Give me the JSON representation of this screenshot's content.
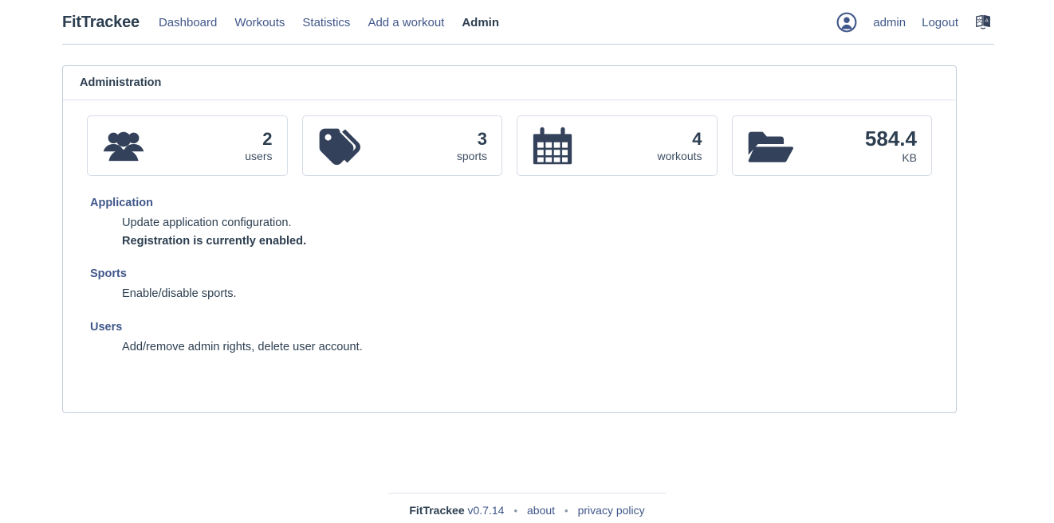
{
  "header": {
    "brand": "FitTrackee",
    "nav": [
      {
        "label": "Dashboard",
        "name": "nav-dashboard",
        "active": false
      },
      {
        "label": "Workouts",
        "name": "nav-workouts",
        "active": false
      },
      {
        "label": "Statistics",
        "name": "nav-statistics",
        "active": false
      },
      {
        "label": "Add a workout",
        "name": "nav-add-a-workout",
        "active": false
      },
      {
        "label": "Admin",
        "name": "nav-admin",
        "active": true
      }
    ],
    "username": "admin",
    "logout": "Logout",
    "avatar_icon": "user-circle-icon",
    "language_icon": "language-icon"
  },
  "card": {
    "title": "Administration"
  },
  "stats": [
    {
      "icon": "users-icon",
      "value": "2",
      "label": "users",
      "name": "stat-card-users"
    },
    {
      "icon": "tags-icon",
      "value": "3",
      "label": "sports",
      "name": "stat-card-sports"
    },
    {
      "icon": "calendar-icon",
      "value": "4",
      "label": "workouts",
      "name": "stat-card-workouts"
    },
    {
      "icon": "folder-open-icon",
      "value": "584.4",
      "label": "KB",
      "name": "stat-card-storage"
    }
  ],
  "sections": [
    {
      "title": "Application",
      "name": "section-application",
      "lines": [
        {
          "text": "Update application configuration.",
          "bold": false
        },
        {
          "text": "Registration is currently enabled.",
          "bold": true
        }
      ]
    },
    {
      "title": "Sports",
      "name": "section-sports",
      "lines": [
        {
          "text": "Enable/disable sports.",
          "bold": false
        }
      ]
    },
    {
      "title": "Users",
      "name": "section-users",
      "lines": [
        {
          "text": "Add/remove admin rights, delete user account.",
          "bold": false
        }
      ]
    }
  ],
  "footer": {
    "brand": "FitTrackee",
    "version": "v0.7.14",
    "separator": "•",
    "about": "about",
    "privacy": "privacy policy"
  },
  "colors": {
    "accent_blue": "#40578a",
    "text_dark": "#2c3e50",
    "icon_navy": "#33415a",
    "border": "#c3cdda"
  }
}
